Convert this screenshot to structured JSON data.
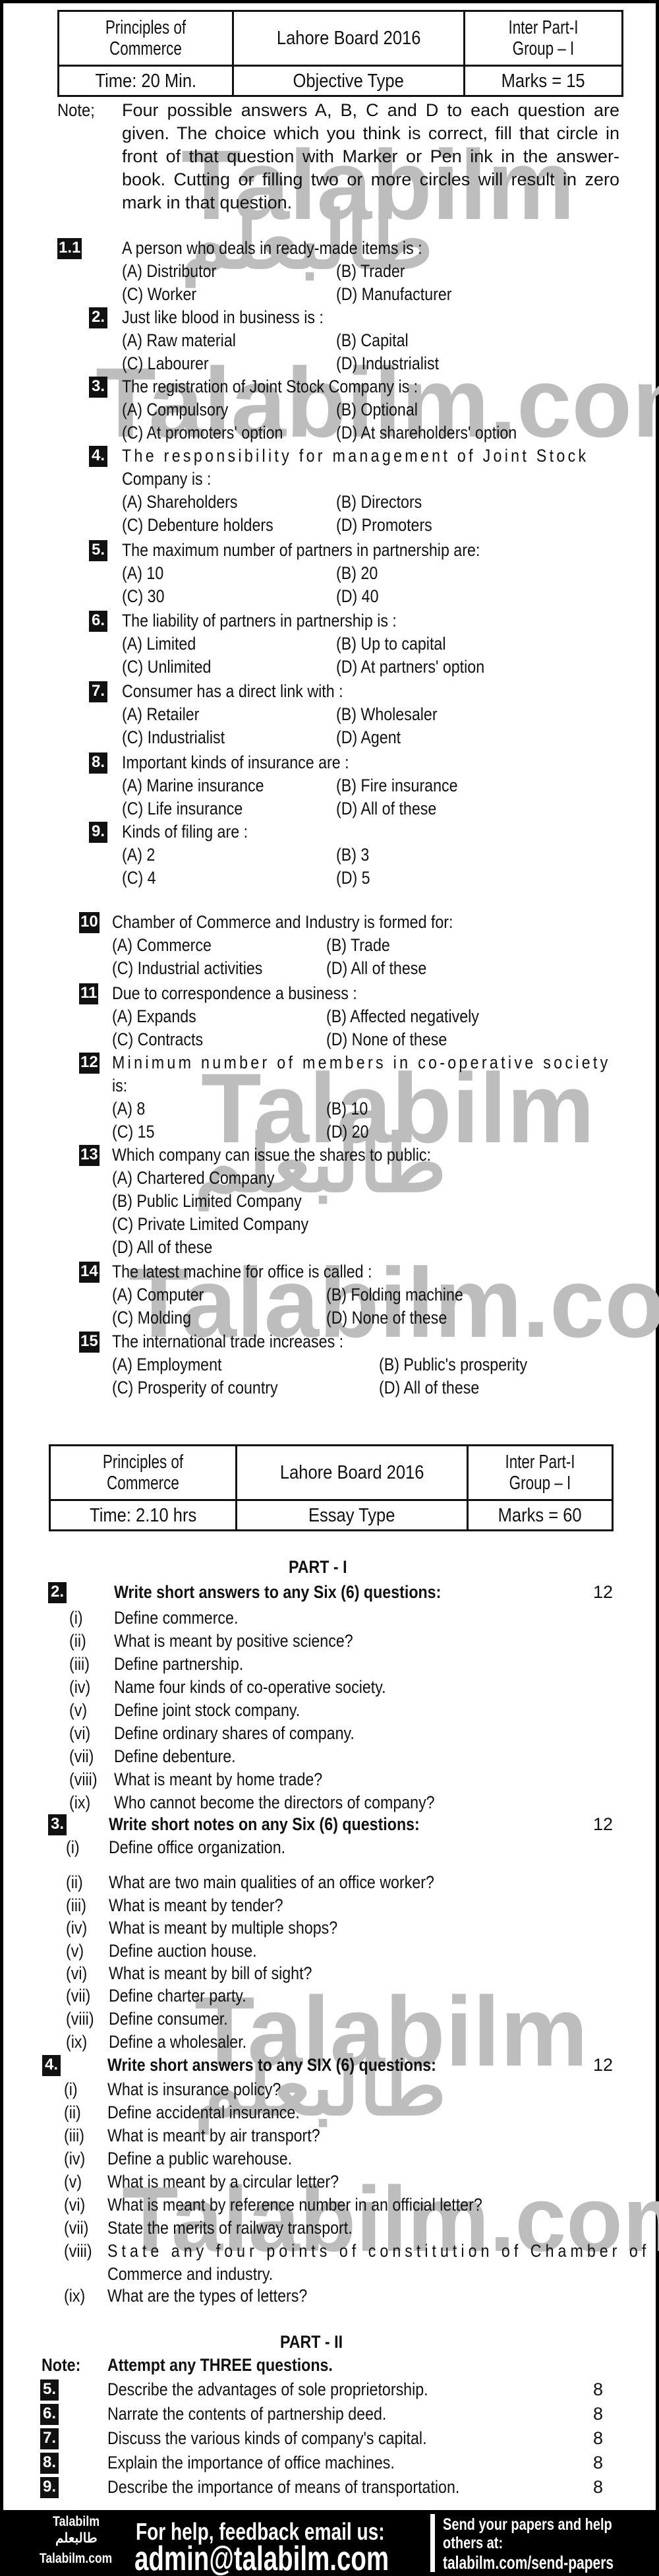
{
  "objective": {
    "header": {
      "subject": "Principles of Commerce",
      "subject_line1": "Principles of",
      "subject_line2": "Commerce",
      "board": "Lahore Board 2016",
      "level_line1": "Inter Part-I",
      "level_line2": "Group – I",
      "time": "Time: 20 Min.",
      "type": "Objective Type",
      "marks": "Marks = 15"
    },
    "note": {
      "label": "Note;",
      "text": "Four possible answers A, B, C and D to each question are given. The choice which you think is correct, fill that circle in front of that question with Marker or Pen ink in the answer-book. Cutting or filling two or more circles will result in zero mark in that question."
    },
    "questions": [
      {
        "num": "1.1",
        "text": "A person who deals in ready-made items is :",
        "options": [
          "(A) Distributor",
          "(B) Trader",
          "(C) Worker",
          "(D) Manufacturer"
        ]
      },
      {
        "num": "2.",
        "text": "Just like blood in business is :",
        "options": [
          "(A) Raw material",
          "(B) Capital",
          "(C) Labourer",
          "(D) Industrialist"
        ]
      },
      {
        "num": "3.",
        "text": "The registration of Joint Stock Company is :",
        "options": [
          "(A) Compulsory",
          "(B) Optional",
          "(C) At promoters' option",
          "(D) At shareholders' option"
        ]
      },
      {
        "num": "4.",
        "text_line1": "The responsibility for management of Joint Stock",
        "text_line2": "Company is :",
        "options": [
          "(A) Shareholders",
          "(B) Directors",
          "(C) Debenture holders",
          "(D) Promoters"
        ]
      },
      {
        "num": "5.",
        "text": "The maximum number of partners in partnership are:",
        "options": [
          "(A) 10",
          "(B) 20",
          "(C) 30",
          "(D) 40"
        ]
      },
      {
        "num": "6.",
        "text": "The liability of partners in partnership is :",
        "options": [
          "(A) Limited",
          "(B) Up to capital",
          "(C) Unlimited",
          "(D) At partners' option"
        ]
      },
      {
        "num": "7.",
        "text": "Consumer has a direct link with :",
        "options": [
          "(A) Retailer",
          "(B) Wholesaler",
          "(C) Industrialist",
          "(D) Agent"
        ]
      },
      {
        "num": "8.",
        "text": "Important kinds of insurance are :",
        "options": [
          "(A) Marine insurance",
          "(B) Fire insurance",
          "(C) Life insurance",
          "(D) All of these"
        ]
      },
      {
        "num": "9.",
        "text": "Kinds of filing are :",
        "options": [
          "(A) 2",
          "(B) 3",
          "(C) 4",
          "(D) 5"
        ]
      },
      {
        "num": "10",
        "text": "Chamber of Commerce and Industry is formed for:",
        "options": [
          "(A) Commerce",
          "(B) Trade",
          "(C) Industrial activities",
          "(D) All of these"
        ]
      },
      {
        "num": "11",
        "text": "Due to correspondence a business :",
        "options": [
          "(A) Expands",
          "(B) Affected negatively",
          "(C) Contracts",
          "(D) None of these"
        ]
      },
      {
        "num": "12",
        "text_line1": "Minimum number of members in co-operative society",
        "text_line2": "is:",
        "options": [
          "(A) 8",
          "(B) 10",
          "(C) 15",
          "(D) 20"
        ]
      },
      {
        "num": "13",
        "text": "Which company can issue the shares to public:",
        "options": [
          "(A) Chartered Company",
          "(B) Public Limited Company",
          "(C) Private Limited Company",
          "(D) All of these"
        ]
      },
      {
        "num": "14",
        "text": "The latest machine for office is called :",
        "options": [
          "(A) Computer",
          "(B) Folding machine",
          "(C) Molding",
          "(D) None of these"
        ]
      },
      {
        "num": "15",
        "text": "The international trade increases :",
        "options": [
          "(A) Employment",
          "(B) Public's prosperity",
          "(C) Prosperity of country",
          "(D) All of these"
        ]
      }
    ]
  },
  "essay": {
    "header": {
      "subject_line1": "Principles of",
      "subject_line2": "Commerce",
      "board": "Lahore Board 2016",
      "level_line1": "Inter Part-I",
      "level_line2": "Group – I",
      "time": "Time: 2.10 hrs",
      "type": "Essay Type",
      "marks": "Marks = 60"
    },
    "part1": {
      "title": "PART - I",
      "questions": [
        {
          "num": "2.",
          "heading": "Write short answers to any Six (6) questions:",
          "marks": "12",
          "items": [
            {
              "roman": "(i)",
              "text": "Define commerce."
            },
            {
              "roman": "(ii)",
              "text": "What is meant by positive science?"
            },
            {
              "roman": "(iii)",
              "text": "Define partnership."
            },
            {
              "roman": "(iv)",
              "text": "Name four kinds of co-operative society."
            },
            {
              "roman": "(v)",
              "text": "Define joint stock company."
            },
            {
              "roman": "(vi)",
              "text": "Define ordinary shares of company."
            },
            {
              "roman": "(vii)",
              "text": "Define debenture."
            },
            {
              "roman": "(viii)",
              "text": "What is meant by home trade?"
            },
            {
              "roman": "(ix)",
              "text": "Who cannot become the directors of company?"
            }
          ]
        },
        {
          "num": "3.",
          "heading": "Write short notes on any Six (6) questions:",
          "marks": "12",
          "items": [
            {
              "roman": "(i)",
              "text": "Define office organization."
            },
            {
              "roman": "(ii)",
              "text": "What are two main qualities of an office worker?"
            },
            {
              "roman": "(iii)",
              "text": "What is meant by tender?"
            },
            {
              "roman": "(iv)",
              "text": "What is meant by multiple shops?"
            },
            {
              "roman": "(v)",
              "text": "Define auction house."
            },
            {
              "roman": "(vi)",
              "text": "What is meant by bill of sight?"
            },
            {
              "roman": "(vii)",
              "text": "Define charter party."
            },
            {
              "roman": "(viii)",
              "text": "Define consumer."
            },
            {
              "roman": "(ix)",
              "text": "Define a wholesaler."
            }
          ]
        },
        {
          "num": "4.",
          "heading": "Write short answers to any SIX (6) questions:",
          "marks": "12",
          "items": [
            {
              "roman": "(i)",
              "text": "What is insurance policy?"
            },
            {
              "roman": "(ii)",
              "text": "Define accidental insurance."
            },
            {
              "roman": "(iii)",
              "text": "What is meant by air transport?"
            },
            {
              "roman": "(iv)",
              "text": "Define a public warehouse."
            },
            {
              "roman": "(v)",
              "text": "What is meant by a circular letter?"
            },
            {
              "roman": "(vi)",
              "text": "What is meant by reference number in an official letter?"
            },
            {
              "roman": "(vii)",
              "text": "State the merits of railway transport."
            },
            {
              "roman": "(viii)",
              "text": "State any four points of constitution of Chamber of",
              "text_cont": "Commerce and industry."
            },
            {
              "roman": "(ix)",
              "text": "What are the types of letters?"
            }
          ]
        }
      ]
    },
    "part2": {
      "title": "PART - II",
      "note_label": "Note:",
      "note_text": "Attempt any THREE questions.",
      "questions": [
        {
          "num": "5.",
          "text": "Describe the advantages of sole proprietorship.",
          "marks": "8"
        },
        {
          "num": "6.",
          "text": "Narrate the contents of partnership deed.",
          "marks": "8"
        },
        {
          "num": "7.",
          "text": "Discuss the various kinds of company's capital.",
          "marks": "8"
        },
        {
          "num": "8.",
          "text": "Explain the importance of office machines.",
          "marks": "8"
        },
        {
          "num": "9.",
          "text": "Describe the importance of means of transportation.",
          "marks": "8"
        }
      ]
    }
  },
  "watermark": {
    "latin": "Talabilm",
    "latin_com": "Talabilm.com",
    "urdu": "طالبعلم",
    "color": "#bdbdbd"
  },
  "footer": {
    "logo_top": "Talabilm",
    "logo_urdu": "طالبعلم",
    "logo_bottom": "Talabilm.com",
    "help_label": "For help, feedback email us:",
    "email": "admin@talabilm.com",
    "send_line1": "Send your papers and help",
    "send_line2": "others at:",
    "send_link": "talabilm.com/send-papers"
  }
}
